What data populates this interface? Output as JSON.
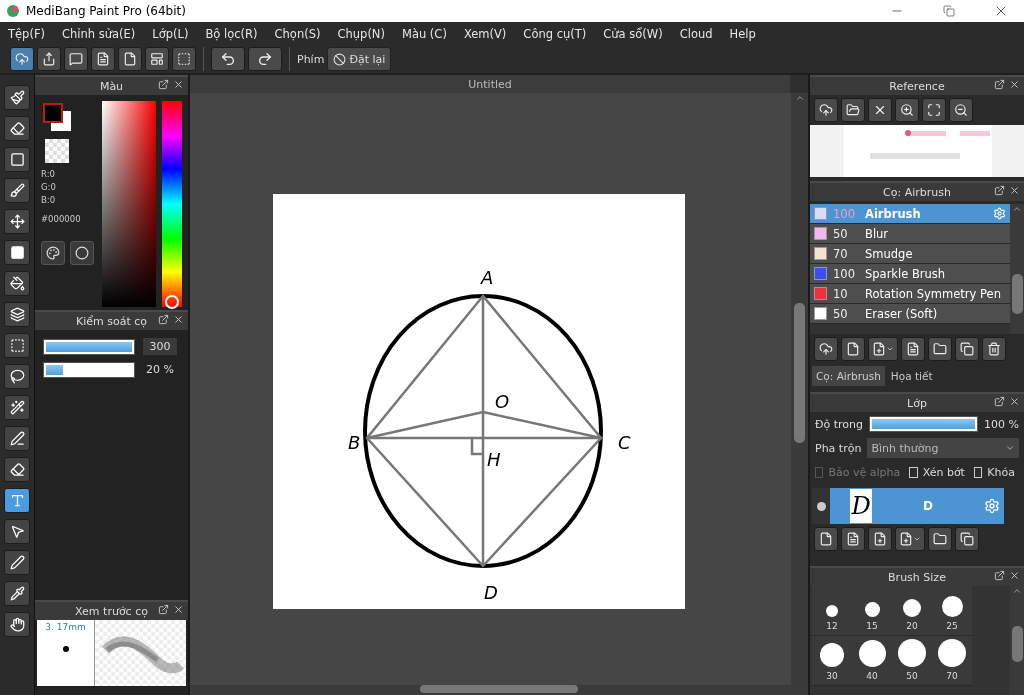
{
  "window": {
    "title": "MediBang Paint Pro (64bit)"
  },
  "menu": [
    "Tệp(F)",
    "Chỉnh sửa(E)",
    "Lớp(L)",
    "Bộ lọc(R)",
    "Chọn(S)",
    "Chụp(N)",
    "Màu (C)",
    "Xem(V)",
    "Công cụ(T)",
    "Cửa sổ(W)",
    "Cloud",
    "Help"
  ],
  "toolbar": {
    "shortcut_label": "Phím",
    "reset_button": "Đặt lại"
  },
  "tools": [
    {
      "kind": "brush",
      "selected": false
    },
    {
      "kind": "eraser",
      "selected": false
    },
    {
      "kind": "dot",
      "selected": false
    },
    {
      "kind": "edit",
      "selected": false
    },
    {
      "kind": "move",
      "selected": false
    },
    {
      "kind": "fill",
      "selected": false
    },
    {
      "kind": "bucket",
      "selected": false
    },
    {
      "kind": "gradient",
      "selected": false
    },
    {
      "kind": "select",
      "selected": false
    },
    {
      "kind": "lasso",
      "selected": false
    },
    {
      "kind": "wand",
      "selected": false
    },
    {
      "kind": "selectpen",
      "selected": false
    },
    {
      "kind": "selecteraser",
      "selected": false
    },
    {
      "kind": "text",
      "selected": true
    },
    {
      "kind": "operation",
      "selected": false
    },
    {
      "kind": "pen",
      "selected": false
    },
    {
      "kind": "dropper",
      "selected": false
    },
    {
      "kind": "hand",
      "selected": false
    }
  ],
  "color_panel": {
    "title": "Màu",
    "r": "R:0",
    "g": "G:0",
    "b": "B:0",
    "hex": "#000000"
  },
  "brush_control": {
    "title": "Kiểm soát cọ",
    "sliders": [
      {
        "level": 1,
        "reading": "300"
      },
      {
        "level": 0.2,
        "reading": "20 %"
      }
    ]
  },
  "brush_preview": {
    "title": "Xem trước cọ",
    "size": "3. 17mm"
  },
  "document": {
    "tab": "Untitled",
    "labels": [
      "A",
      "O",
      "B",
      "C",
      "H",
      "D"
    ]
  },
  "reference": {
    "title": "Reference"
  },
  "brush_panel": {
    "title": "Cọ: Airbrush",
    "brushes": [
      {
        "size": "100",
        "name": "Airbrush",
        "color": "#d8dcf0",
        "selected": true
      },
      {
        "size": "50",
        "name": "Blur",
        "color": "#f2b6f2",
        "selected": false
      },
      {
        "size": "70",
        "name": "Smudge",
        "color": "#f5e2d2",
        "selected": false
      },
      {
        "size": "100",
        "name": "Sparkle Brush",
        "color": "#3a50f0",
        "selected": false
      },
      {
        "size": "10",
        "name": "Rotation Symmetry Pen",
        "color": "#ee3040",
        "selected": false
      },
      {
        "size": "50",
        "name": "Eraser (Soft)",
        "color": "#ffffff",
        "selected": false
      }
    ],
    "tabs": [
      {
        "label": "Cọ: Airbrush",
        "selected": true
      },
      {
        "label": "Họa tiết",
        "selected": false
      }
    ]
  },
  "layer_panel": {
    "title": "Lớp",
    "opacity_label": "Độ trong",
    "opacity": {
      "level": 1
    },
    "opacity_reading": "100 %",
    "blend_label": "Pha trộn",
    "blend_value": "Bình thường",
    "options": [
      {
        "label": "Bảo vệ alpha",
        "checked": false,
        "disabled": true
      },
      {
        "label": "Xén bớt",
        "checked": false,
        "disabled": false
      },
      {
        "label": "Khóa",
        "checked": false,
        "disabled": false
      }
    ],
    "layers": [
      {
        "name": "D",
        "thumbnail_text": "D",
        "visible": true,
        "selected": true
      }
    ]
  },
  "brush_size": {
    "title": "Brush Size",
    "sizes": [
      "12",
      "15",
      "20",
      "25",
      "30",
      "40",
      "50",
      "70"
    ]
  }
}
